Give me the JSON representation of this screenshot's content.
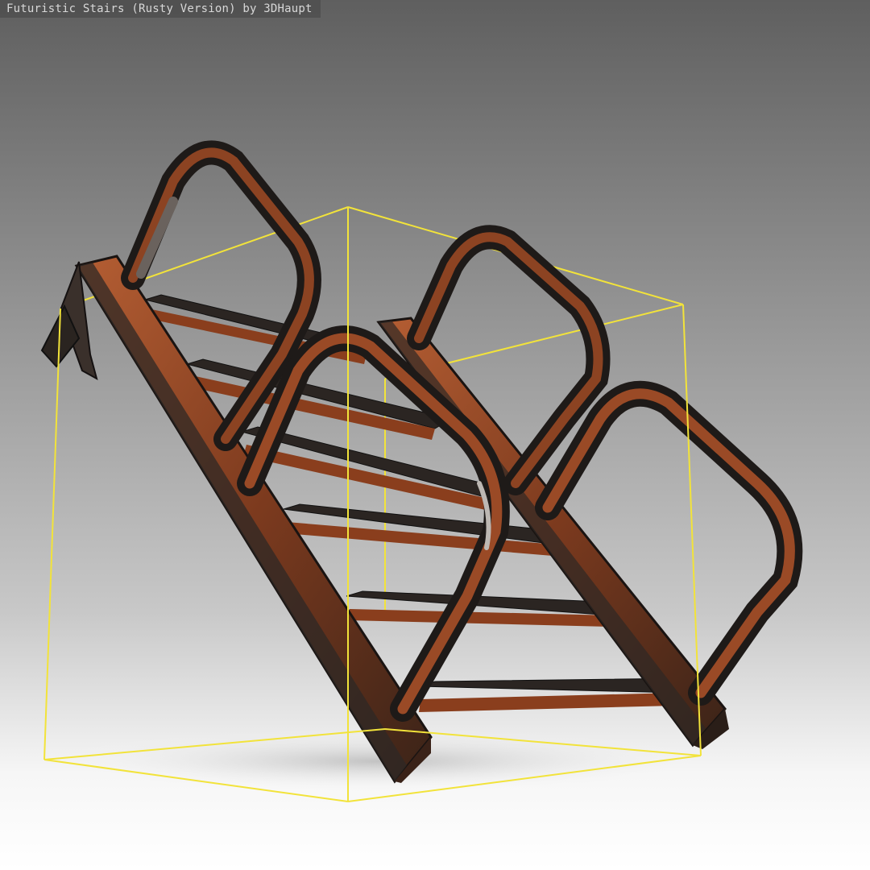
{
  "viewer": {
    "title": "Futuristic Stairs (Rusty Version) by 3DHaupt"
  },
  "colors": {
    "bounding_box": "#f2e33a",
    "rust": "#9a4a26",
    "rust_light": "#c06a3a",
    "metal_dark": "#2a2522",
    "metal_mid": "#4a4440"
  },
  "icons": {
    "model": "stairs-model"
  }
}
